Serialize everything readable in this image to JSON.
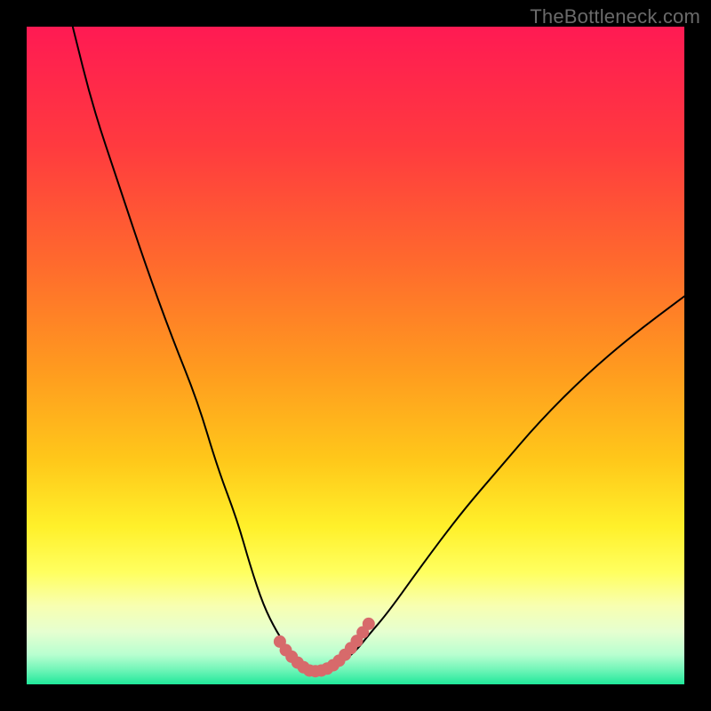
{
  "watermark": "TheBottleneck.com",
  "colors": {
    "frame_bg": "#000000",
    "curve_stroke": "#000000",
    "marker_fill": "#d76a6b",
    "watermark_text": "#6a6a6a",
    "gradient_stops": [
      {
        "offset": "0%",
        "color": "#ff1a53"
      },
      {
        "offset": "18%",
        "color": "#ff3a3f"
      },
      {
        "offset": "36%",
        "color": "#ff6a2d"
      },
      {
        "offset": "52%",
        "color": "#ff9a1f"
      },
      {
        "offset": "66%",
        "color": "#ffc81a"
      },
      {
        "offset": "76%",
        "color": "#fff02a"
      },
      {
        "offset": "83%",
        "color": "#ffff60"
      },
      {
        "offset": "88%",
        "color": "#f8ffb0"
      },
      {
        "offset": "92%",
        "color": "#e6ffd0"
      },
      {
        "offset": "95.5%",
        "color": "#b8ffd0"
      },
      {
        "offset": "97.8%",
        "color": "#70f5b8"
      },
      {
        "offset": "100%",
        "color": "#20e89a"
      }
    ]
  },
  "chart_data": {
    "type": "line",
    "title": "",
    "xlabel": "",
    "ylabel": "",
    "xlim": [
      0,
      100
    ],
    "ylim": [
      0,
      100
    ],
    "series": [
      {
        "name": "bottleneck-curve",
        "x": [
          7,
          10,
          14,
          18,
          22,
          26,
          29,
          32,
          34,
          36,
          38,
          40,
          41.5,
          43,
          44.5,
          46,
          48,
          50,
          52,
          55,
          60,
          66,
          72,
          78,
          85,
          92,
          100
        ],
        "y": [
          100,
          88,
          76,
          64,
          53,
          43,
          33,
          25,
          18,
          12,
          8,
          5,
          3,
          2,
          2,
          2.5,
          3.5,
          5,
          7.5,
          11,
          18,
          26,
          33,
          40,
          47,
          53,
          59
        ]
      }
    ],
    "markers": {
      "name": "highlighted-bottom",
      "x": [
        38.5,
        39.4,
        40.3,
        41.2,
        42.1,
        43.0,
        43.9,
        44.8,
        45.7,
        46.6,
        47.5,
        48.4,
        49.3,
        50.2,
        51.1,
        52.0
      ],
      "y": [
        6.5,
        5.2,
        4.2,
        3.3,
        2.6,
        2.1,
        2.0,
        2.1,
        2.4,
        2.9,
        3.6,
        4.5,
        5.5,
        6.6,
        7.9,
        9.2
      ],
      "radius": 7
    }
  }
}
